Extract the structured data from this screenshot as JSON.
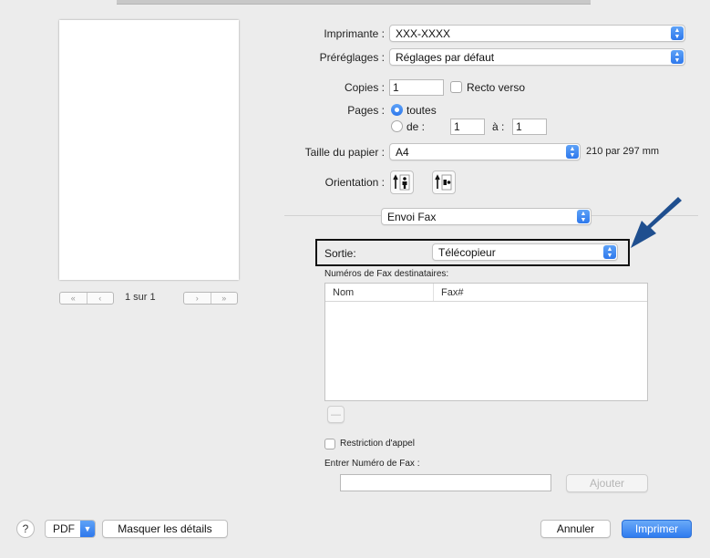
{
  "preview": {
    "page_label": "1 sur 1"
  },
  "printer": {
    "label": "Imprimante :",
    "value": "XXX-XXXX"
  },
  "presets": {
    "label": "Préréglages :",
    "value": "Réglages par défaut"
  },
  "copies": {
    "label": "Copies :",
    "value": "1",
    "duplex_label": "Recto verso"
  },
  "pages": {
    "label": "Pages :",
    "all_label": "toutes",
    "from_label": "de :",
    "from_value": "1",
    "to_label": "à :",
    "to_value": "1"
  },
  "paper": {
    "label": "Taille du papier :",
    "value": "A4",
    "dimensions": "210 par 297 mm"
  },
  "orientation": {
    "label": "Orientation :"
  },
  "section": {
    "value": "Envoi Fax"
  },
  "output": {
    "label": "Sortie:",
    "value": "Télécopieur"
  },
  "recipients": {
    "label": "Numéros de Fax destinataires:",
    "col_name": "Nom",
    "col_fax": "Fax#",
    "remove_label": "—"
  },
  "restriction": {
    "label": "Restriction d'appel"
  },
  "fax_entry": {
    "label": "Entrer Numéro de Fax :",
    "value": "",
    "add_label": "Ajouter"
  },
  "footer": {
    "help_label": "?",
    "pdf_label": "PDF",
    "hide_details_label": "Masquer les détails",
    "cancel_label": "Annuler",
    "print_label": "Imprimer"
  },
  "colors": {
    "accent": "#2e78ec",
    "arrow": "#1f4f8f"
  },
  "icons": {
    "nav_first": "«",
    "nav_prev": "‹",
    "nav_next": "›",
    "nav_last": "»",
    "stepper": "up-down-chevron-icon"
  }
}
